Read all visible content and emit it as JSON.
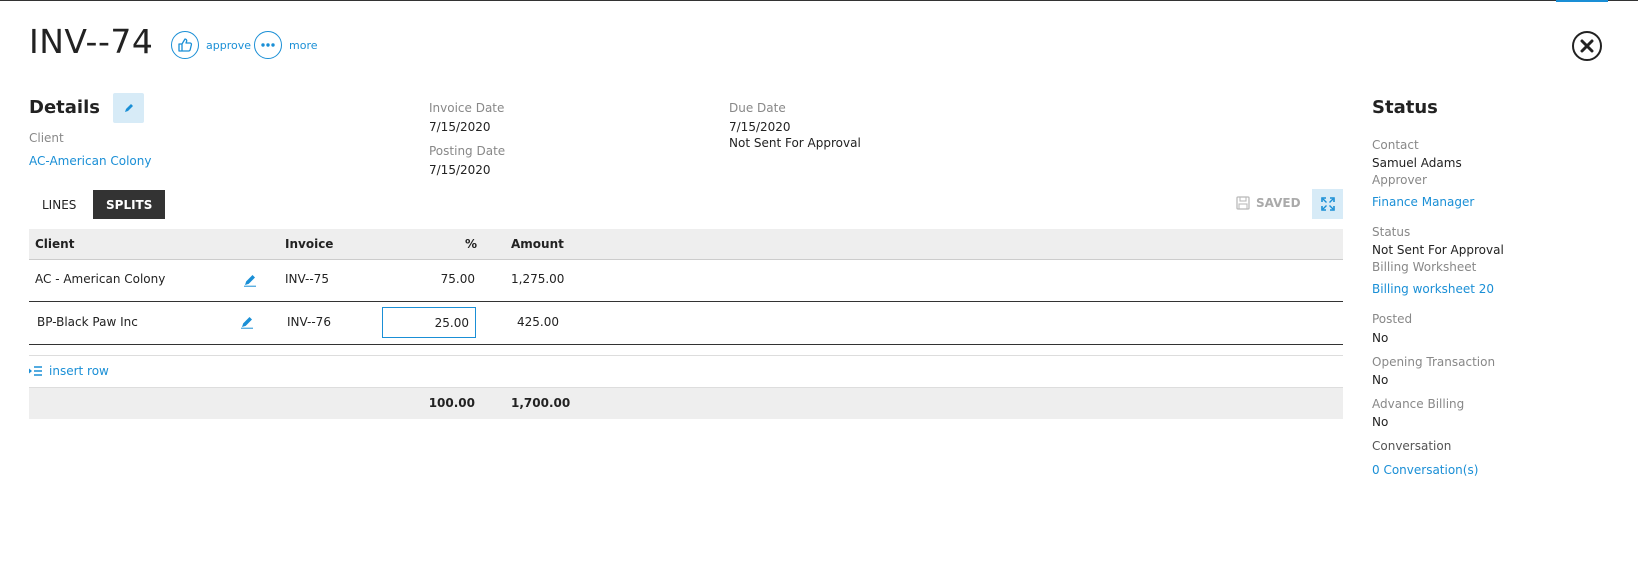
{
  "header": {
    "title": "INV--74",
    "approve_label": "approve",
    "more_label": "more"
  },
  "details": {
    "heading": "Details",
    "client_label": "Client",
    "client_value": "AC-American Colony",
    "invoice_date_label": "Invoice Date",
    "invoice_date_value": "7/15/2020",
    "posting_date_label": "Posting Date",
    "posting_date_value": "7/15/2020",
    "due_date_label": "Due Date",
    "due_date_value": "7/15/2020",
    "approval_status": "Not Sent For Approval"
  },
  "tabs": {
    "lines": "LINES",
    "splits": "SPLITS",
    "active": "SPLITS"
  },
  "toolbar": {
    "saved_label": "SAVED"
  },
  "table": {
    "headers": {
      "client": "Client",
      "invoice": "Invoice",
      "percent": "%",
      "amount": "Amount"
    },
    "rows": [
      {
        "client": "AC - American Colony",
        "invoice": "INV--75",
        "percent": "75.00",
        "amount": "1,275.00"
      },
      {
        "client": "BP-Black Paw Inc",
        "invoice": "INV--76",
        "percent": "25.00",
        "amount": "425.00"
      }
    ],
    "insert_row_label": "insert row",
    "totals": {
      "percent": "100.00",
      "amount": "1,700.00"
    }
  },
  "status": {
    "heading": "Status",
    "contact_label": "Contact",
    "contact_value": "Samuel Adams",
    "approver_label": "Approver",
    "approver_value": "Finance Manager",
    "status_label": "Status",
    "status_value": "Not Sent For Approval",
    "billing_worksheet_label": "Billing Worksheet",
    "billing_worksheet_value": "Billing worksheet 20",
    "posted_label": "Posted",
    "posted_value": "No",
    "opening_transaction_label": "Opening Transaction",
    "opening_transaction_value": "No",
    "advance_billing_label": "Advance Billing",
    "advance_billing_value": "No",
    "conversation_label": "Conversation",
    "conversation_value": "0 Conversation(s)"
  },
  "colors": {
    "accent": "#1a8fd6",
    "active_tab": "#333333",
    "light_button": "#d7ebf7"
  }
}
